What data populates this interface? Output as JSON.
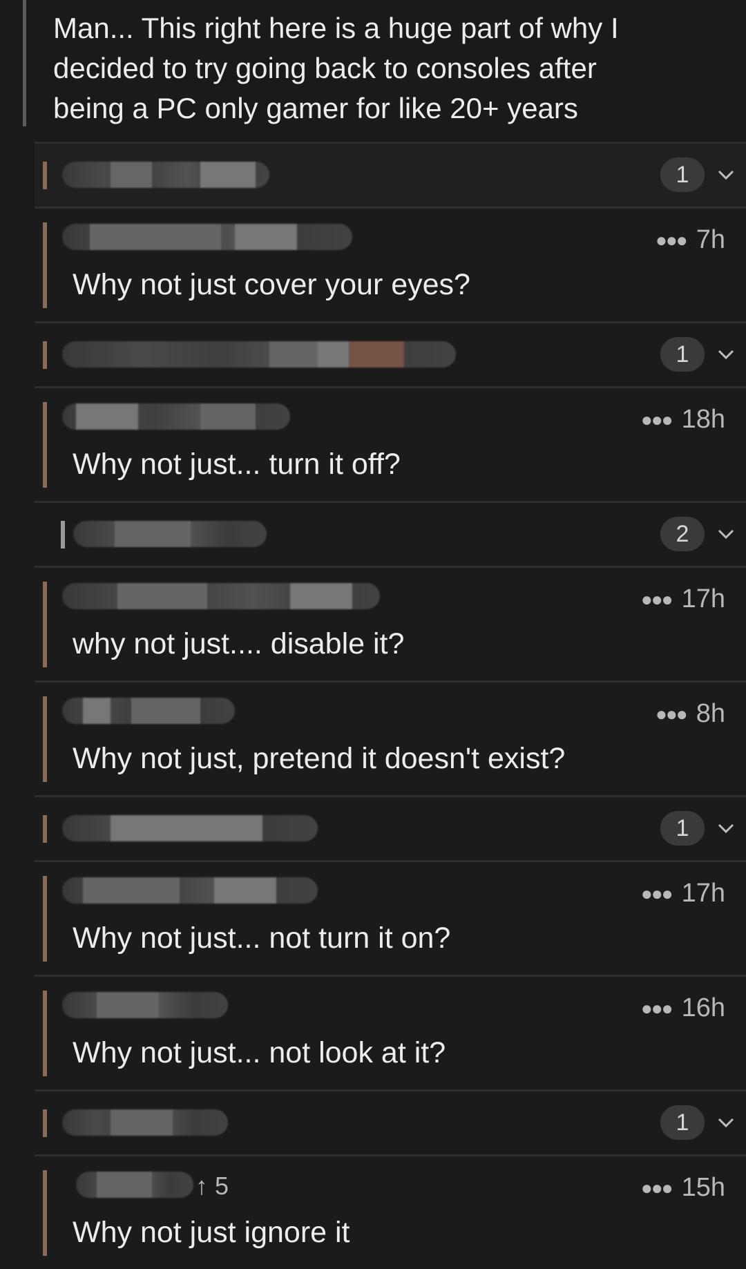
{
  "top_comment": {
    "lines": [
      "Man... This right here is a huge part of why I",
      "decided to try going back to consoles after",
      "being a PC only gamer for like 20+ years"
    ]
  },
  "replies": [
    {
      "kind": "collapsed",
      "count": "1"
    },
    {
      "kind": "expanded",
      "time": "7h",
      "text": "Why not just cover your eyes?"
    },
    {
      "kind": "collapsed",
      "count": "1"
    },
    {
      "kind": "expanded",
      "time": "18h",
      "text": "Why not just... turn it off?"
    },
    {
      "kind": "collapsed",
      "count": "2"
    },
    {
      "kind": "expanded",
      "time": "17h",
      "text": "why not just.... disable it?"
    },
    {
      "kind": "expanded",
      "time": "8h",
      "text": "Why not just, pretend it doesn't exist?"
    },
    {
      "kind": "collapsed",
      "count": "1"
    },
    {
      "kind": "expanded",
      "time": "17h",
      "text": "Why not just... not turn it on?"
    },
    {
      "kind": "expanded",
      "time": "16h",
      "text": "Why not just... not look at it?"
    },
    {
      "kind": "collapsed",
      "count": "1"
    },
    {
      "kind": "expanded",
      "time": "15h",
      "text": "Why not just ignore it",
      "upvote": "↑ 5"
    }
  ],
  "icons": {
    "more": "more-dots-icon",
    "expand": "chevron-down-icon"
  }
}
